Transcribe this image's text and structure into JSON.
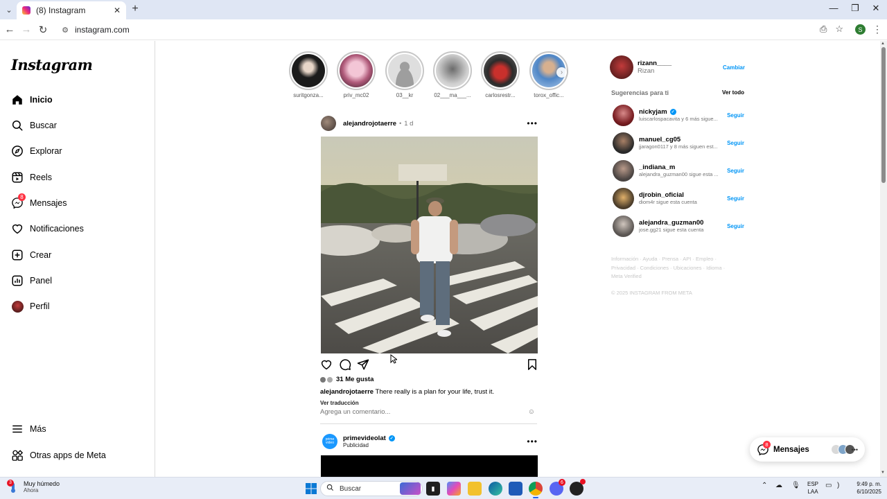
{
  "browser": {
    "tab_title": "(8) Instagram",
    "url": "instagram.com",
    "profile_initial": "S"
  },
  "sidebar": {
    "logo": "Instagram",
    "items": [
      {
        "label": "Inicio",
        "icon": "home-icon"
      },
      {
        "label": "Buscar",
        "icon": "search-icon"
      },
      {
        "label": "Explorar",
        "icon": "compass-icon"
      },
      {
        "label": "Reels",
        "icon": "reels-icon"
      },
      {
        "label": "Mensajes",
        "icon": "messenger-icon",
        "badge": "8"
      },
      {
        "label": "Notificaciones",
        "icon": "heart-icon"
      },
      {
        "label": "Crear",
        "icon": "plus-square-icon"
      },
      {
        "label": "Panel",
        "icon": "bar-chart-icon"
      },
      {
        "label": "Perfil",
        "icon": "profile-avatar"
      }
    ],
    "more": "Más",
    "meta_apps": "Otras apps de Meta"
  },
  "stories": [
    {
      "name": "suritgonza..."
    },
    {
      "name": "priv_mc02"
    },
    {
      "name": "03__kr"
    },
    {
      "name": "02___ma___..."
    },
    {
      "name": "carlosrestr..."
    },
    {
      "name": "torox_offic..."
    }
  ],
  "post": {
    "username": "alejandrojotaerre",
    "separator": "•",
    "time": "1 d",
    "likes": "31 Me gusta",
    "caption_user": "alejandrojotaerre",
    "caption_text": " There really is a plan for your life, trust it.",
    "translate": "Ver traducción",
    "comment_placeholder": "Agrega un comentario..."
  },
  "post2": {
    "username": "primevideolat",
    "avatar_text": "prime video",
    "subtitle": "Publicidad"
  },
  "right": {
    "me_username": "rizann____",
    "me_name": "Rizan",
    "switch": "Cambiar",
    "suggestions_title": "Sugerencias para ti",
    "see_all": "Ver todo",
    "follow": "Seguir",
    "suggestions": [
      {
        "username": "nickyjam",
        "verified": true,
        "sub": "luiscarlospacavita y 6 más sigue..."
      },
      {
        "username": "manuel_cg05",
        "verified": false,
        "sub": "jjaragon0117 y 8 más siguen est..."
      },
      {
        "username": "_indiana_m",
        "verified": false,
        "sub": "alejandra_guzman00 sigue esta ..."
      },
      {
        "username": "djrobin_oficial",
        "verified": false,
        "sub": "diom4r sigue esta cuenta"
      },
      {
        "username": "alejandra_guzman00",
        "verified": false,
        "sub": "jose.gg21 sigue esta cuenta"
      }
    ],
    "footer_line1": "Información · Ayuda · Prensa · API · Empleo ·",
    "footer_line2": "Privacidad · Condiciones · Ubicaciones · Idioma ·",
    "footer_line3": "Meta Verified",
    "copyright": "© 2025 INSTAGRAM FROM META"
  },
  "messages_pill": {
    "label": "Mensajes",
    "badge": "8"
  },
  "taskbar": {
    "weather_badge": "3",
    "weather_title": "Muy húmedo",
    "weather_sub": "Ahora",
    "search_placeholder": "Buscar",
    "lang_1": "ESP",
    "lang_2": "LAA",
    "time": "9:49 p. m.",
    "date": "6/10/2025",
    "discord_badge": "6"
  },
  "colors": {
    "accent": "#0095f6",
    "badge": "#ff3040",
    "border": "#dbdbdb",
    "muted": "#737373"
  }
}
